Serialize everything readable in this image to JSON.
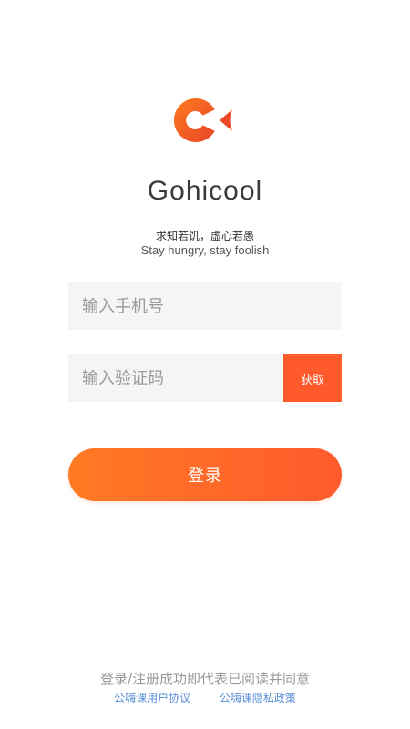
{
  "branding": {
    "app_name": "Gohicool",
    "slogan_cn": "求知若饥，虚心若愚",
    "slogan_en": "Stay hungry, stay foolish",
    "logo_icon": "gohicool-logo-icon",
    "accent_color": "#ff5a2c"
  },
  "form": {
    "phone_placeholder": "输入手机号",
    "code_placeholder": "输入验证码",
    "get_code_label": "获取",
    "login_label": "登录"
  },
  "agreement": {
    "text": "登录/注册成功即代表已阅读并同意",
    "user_agreement_link": "公嗨课用户协议",
    "privacy_policy_link": "公嗨课隐私政策",
    "link_color": "#5b8fd6"
  }
}
